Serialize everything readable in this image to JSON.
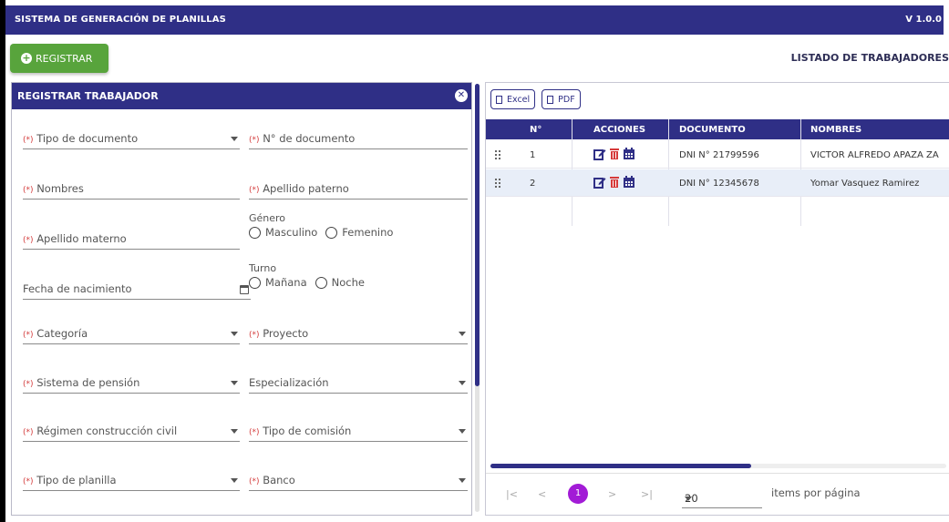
{
  "app": {
    "title": "SISTEMA DE GENERACIÓN DE PLANILLAS",
    "version": "V 1.0.0"
  },
  "toolbar": {
    "register_label": "REGISTRAR"
  },
  "list": {
    "title": "LISTADO DE TRABAJADORES"
  },
  "form": {
    "title": "REGISTRAR TRABAJADOR",
    "required_mark": "(*)",
    "tipo_documento": "Tipo de documento",
    "numero_documento": "N° de documento",
    "nombres": "Nombres",
    "apellido_paterno": "Apellido paterno",
    "apellido_materno": "Apellido materno",
    "genero": {
      "label": "Género",
      "options": [
        "Masculino",
        "Femenino"
      ]
    },
    "fecha_nacimiento": "Fecha de nacimiento",
    "turno": {
      "label": "Turno",
      "options": [
        "Mañana",
        "Noche"
      ]
    },
    "categoria": "Categoría",
    "proyecto": "Proyecto",
    "sistema_pension": "Sistema de pensión",
    "especializacion": "Especialización",
    "regimen": "Régimen construcción civil",
    "tipo_comision": "Tipo de comisión",
    "tipo_planilla": "Tipo de planilla",
    "banco": "Banco"
  },
  "table": {
    "export": {
      "excel": "Excel",
      "pdf": "PDF"
    },
    "columns": [
      "N°",
      "ACCIONES",
      "DOCUMENTO",
      "NOMBRES"
    ],
    "rows": [
      {
        "n": "1",
        "documento": "DNI N° 21799596",
        "nombres": "VICTOR ALFREDO APAZA ZA"
      },
      {
        "n": "2",
        "documento": "DNI N° 12345678",
        "nombres": "Yomar Vasquez Ramirez"
      }
    ]
  },
  "pager": {
    "first": "|<",
    "prev": "<",
    "next": ">",
    "last": ">|",
    "current_page": "1",
    "page_size": "20",
    "page_size_label": "items por página"
  },
  "colors": {
    "primary": "#2f2f86",
    "success": "#58a43c",
    "danger": "#d63a3a",
    "page_active": "#a21bd6"
  }
}
